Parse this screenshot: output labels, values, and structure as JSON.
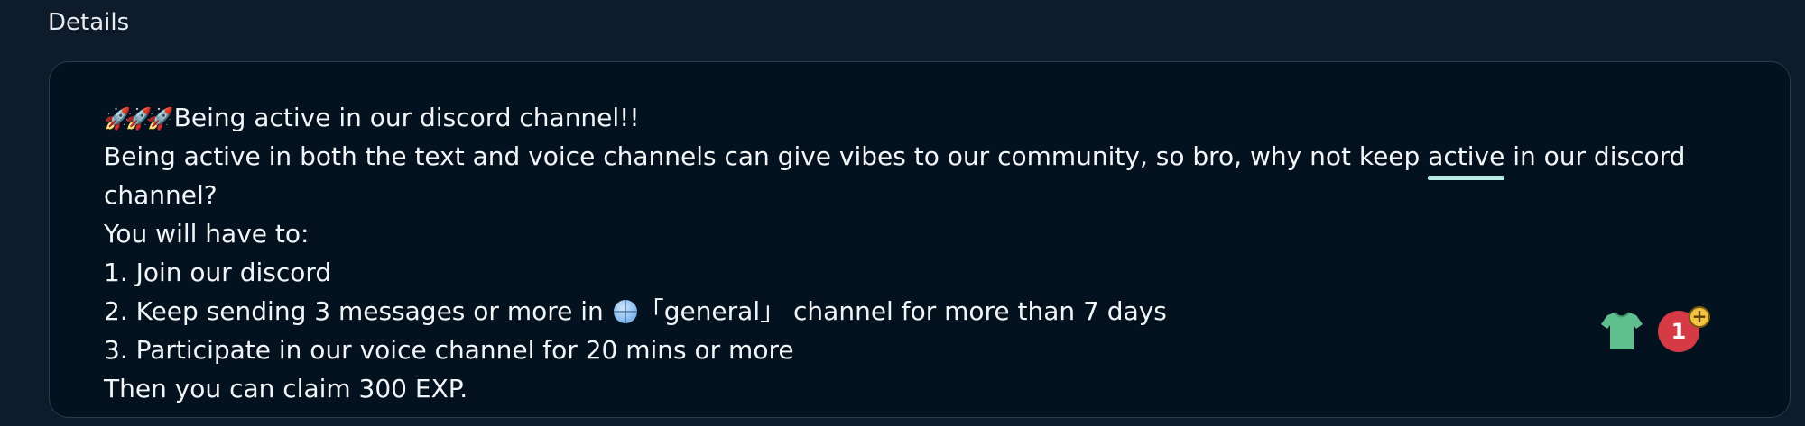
{
  "section": {
    "title": "Details"
  },
  "details": {
    "line1": "Being active in our discord channel!!",
    "line2_before": "Being active in both the text and voice channels can give vibes to our community, so bro, why not keep ",
    "line2_highlight": "active",
    "line2_after": " in our discord",
    "line3": "channel?",
    "line4": "You will have to:",
    "line5": "1. Join our discord",
    "line6_before": "2. Keep sending 3 messages or more in ",
    "line6_channel": "「general」",
    "line6_after": " channel for more than 7 days",
    "line7": "3. Participate in our voice channel for 20 mins or more",
    "line8": "Then you can claim 300 EXP."
  },
  "widgets": {
    "shirt_icon": "t-shirt-icon",
    "badge_count": "1",
    "plus_symbol": "+",
    "colors": {
      "shirt": "#5fbf8f",
      "badge": "#d63a45",
      "plus": "#f2c245",
      "underline": "#b9ece6"
    }
  },
  "icons": {
    "rocket": "rocket-emoji",
    "globe": "globe-emoji"
  }
}
